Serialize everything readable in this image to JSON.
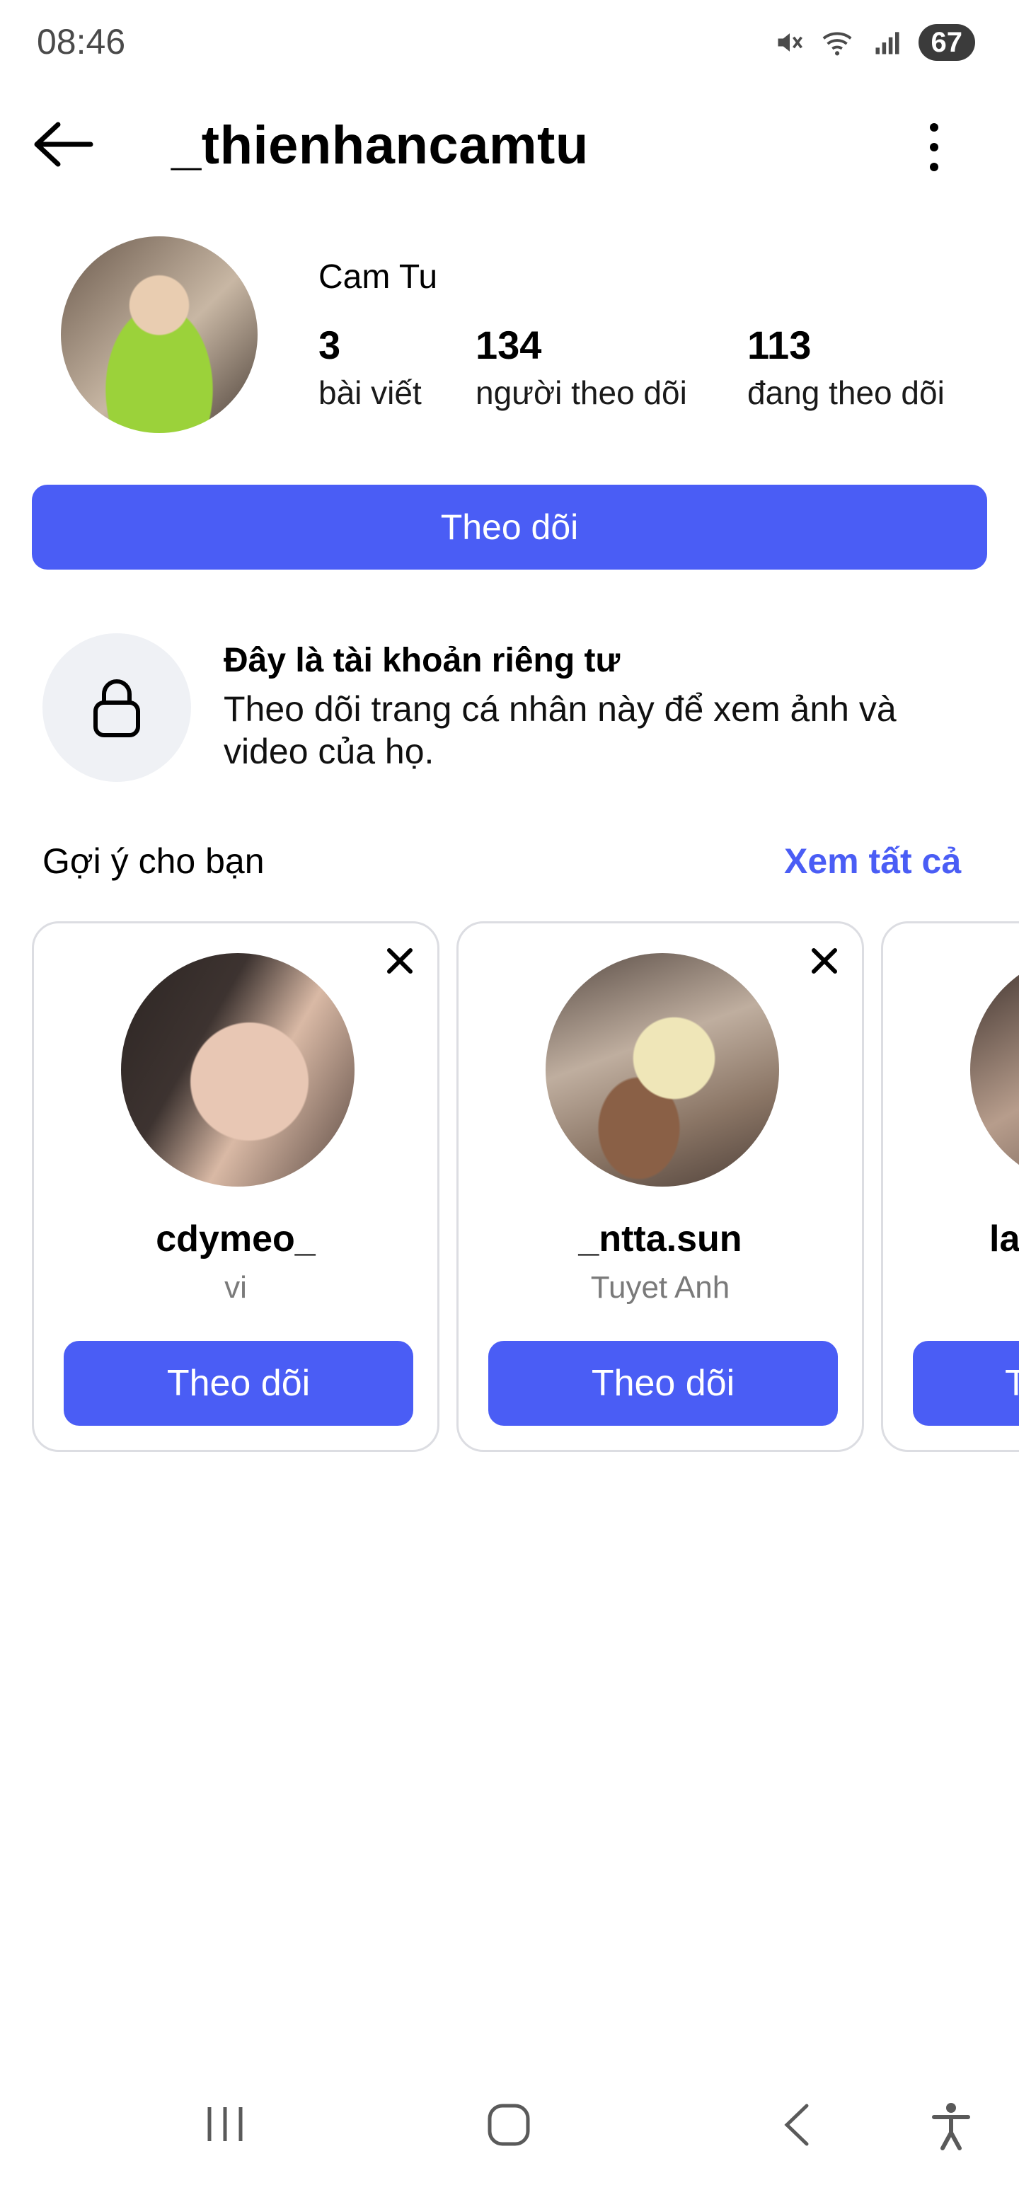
{
  "status_bar": {
    "time": "08:46",
    "battery": "67"
  },
  "header": {
    "username": "_thienhancamtu"
  },
  "profile": {
    "display_name": "Cam Tu",
    "stats": [
      {
        "value": "3",
        "label": "bài viết"
      },
      {
        "value": "134",
        "label": "người theo dõi"
      },
      {
        "value": "113",
        "label": "đang theo dõi"
      }
    ],
    "follow_label": "Theo dõi"
  },
  "private": {
    "title": "Đây là tài khoản riêng tư",
    "description": "Theo dõi trang cá nhân này để xem ảnh và video của họ."
  },
  "suggestions": {
    "title": "Gợi ý cho bạn",
    "see_all": "Xem tất cả",
    "cards": [
      {
        "username": "cdymeo_",
        "subtitle": "vi",
        "button": "Theo dõi"
      },
      {
        "username": "_ntta.sun",
        "subtitle": "Tuyet Anh",
        "button": "Theo dõi"
      },
      {
        "username": "la",
        "subtitle": "",
        "button": "T"
      }
    ]
  },
  "colors": {
    "accent": "#4a5df5",
    "card_border": "#dcdde2",
    "lock_bg": "#eff1f5"
  },
  "icons": [
    "muted-icon",
    "wifi-icon",
    "signal-icon",
    "back-arrow-icon",
    "more-vertical-icon",
    "lock-icon",
    "close-icon",
    "recent-apps-icon",
    "home-icon",
    "nav-back-icon",
    "accessibility-icon"
  ]
}
